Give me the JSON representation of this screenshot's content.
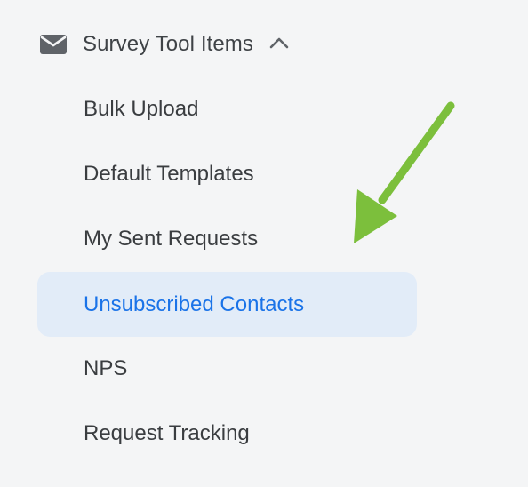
{
  "sidebar": {
    "section": {
      "title": "Survey Tool Items",
      "icon": "mail-icon",
      "toggle_icon": "chevron-up-icon",
      "expanded": true
    },
    "items": [
      {
        "label": "Bulk Upload",
        "active": false
      },
      {
        "label": "Default Templates",
        "active": false
      },
      {
        "label": "My Sent Requests",
        "active": false
      },
      {
        "label": "Unsubscribed Contacts",
        "active": true
      },
      {
        "label": "NPS",
        "active": false
      },
      {
        "label": "Request Tracking",
        "active": false
      }
    ]
  },
  "annotation": {
    "type": "arrow",
    "color": "#7cbf3c",
    "points_to": "Unsubscribed Contacts"
  },
  "colors": {
    "background": "#f4f5f6",
    "active_bg": "#e2ecf8",
    "active_text": "#1a73e8",
    "text": "#3a3d40",
    "icon": "#5f6368"
  }
}
